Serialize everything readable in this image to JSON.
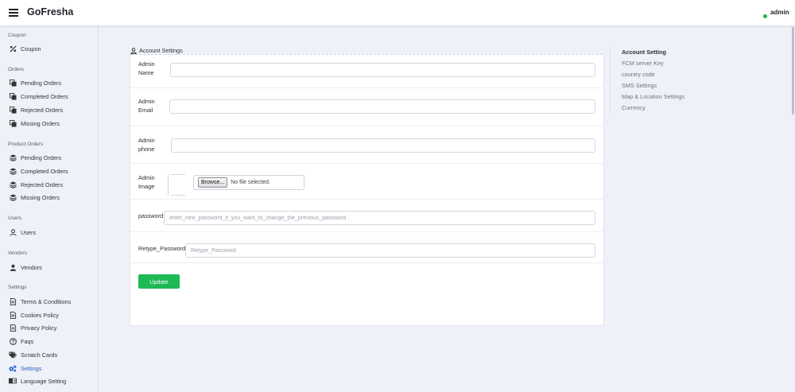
{
  "header": {
    "brand": "GoFresha",
    "user": "admin",
    "status_color": "#22b14c"
  },
  "sidebar": {
    "sections": [
      {
        "title": "Coupon",
        "items": [
          {
            "label": "Coupon",
            "icon": "percent-icon"
          }
        ]
      },
      {
        "title": "Orders",
        "items": [
          {
            "label": "Pending Orders",
            "icon": "copy-icon"
          },
          {
            "label": "Completed Orders",
            "icon": "copy-icon"
          },
          {
            "label": "Rejected Orders",
            "icon": "copy-icon"
          },
          {
            "label": "Missing Orders",
            "icon": "copy-icon"
          }
        ]
      },
      {
        "title": "Product Orders",
        "items": [
          {
            "label": "Pending Orders",
            "icon": "layers-icon"
          },
          {
            "label": "Completed Orders",
            "icon": "layers-icon"
          },
          {
            "label": "Rejected Orders",
            "icon": "layers-icon"
          },
          {
            "label": "Missing Orders",
            "icon": "layers-icon"
          }
        ]
      },
      {
        "title": "Users",
        "items": [
          {
            "label": "Users",
            "icon": "user-icon"
          }
        ]
      },
      {
        "title": "Vendors",
        "items": [
          {
            "label": "Vendors",
            "icon": "vendor-icon"
          }
        ]
      },
      {
        "title": "Settings",
        "items": [
          {
            "label": "Terms & Conditions",
            "icon": "document-icon"
          },
          {
            "label": "Cookies Policy",
            "icon": "document-icon"
          },
          {
            "label": "Privacy Policy",
            "icon": "document-icon"
          },
          {
            "label": "Faqs",
            "icon": "question-icon"
          },
          {
            "label": "Scratch Cards",
            "icon": "tags-icon"
          },
          {
            "label": "Settings",
            "icon": "cogs-icon",
            "active": true
          },
          {
            "label": "Language Setting",
            "icon": "language-icon"
          }
        ]
      }
    ]
  },
  "form": {
    "title": "Account Settings",
    "admin_name_label": "Admin Name",
    "admin_name_value": "",
    "admin_email_label": "Admin Email",
    "admin_email_value": "",
    "admin_phone_label": "Admin phone",
    "admin_phone_value": "",
    "admin_image_label": "Admin Image",
    "browse_label": "Browse...",
    "file_status": "No file selected.",
    "password_label": "password",
    "password_placeholder": "enter_new_password_if_you_want_to_change_the_previous_password",
    "retype_label": "Retype_Password",
    "retype_placeholder": "Retype_Password",
    "update_label": "Update",
    "accent_color": "#1db954"
  },
  "settings_menu": {
    "items": [
      "Account Setting",
      "FCM server Key",
      "country code",
      "SMS Settings",
      "Map & Location Settings",
      "Currency"
    ]
  }
}
